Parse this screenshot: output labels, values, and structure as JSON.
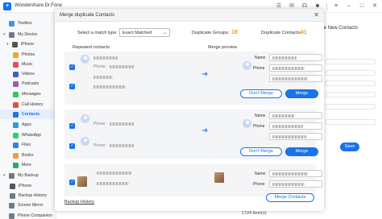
{
  "app": {
    "title": "Wondershare Dr.Fone",
    "logo": "+"
  },
  "titlebar_icons": [
    "hamburger-icon",
    "mail-icon",
    "headset-icon",
    "user-icon",
    "list-icon",
    "minimize-icon",
    "maximize-icon",
    "close-icon"
  ],
  "sidebar": {
    "items": [
      {
        "label": "Toolbox",
        "icon_color": "#4a90e2",
        "level": 0
      },
      {
        "label": "My Device",
        "icon_color": "#6f7b8a",
        "level": 0,
        "expanded": true
      },
      {
        "label": "iPhone",
        "icon_color": "#555555",
        "level": 1,
        "expanded": true
      },
      {
        "label": "Photos",
        "icon_color": "#f5a623",
        "level": 2
      },
      {
        "label": "Music",
        "icon_color": "#e94b5b",
        "level": 2
      },
      {
        "label": "Videos",
        "icon_color": "#3b5bdb",
        "level": 2
      },
      {
        "label": "Podcasts",
        "icon_color": "#9b59b6",
        "level": 2
      },
      {
        "label": "Messages",
        "icon_color": "#34c759",
        "level": 2
      },
      {
        "label": "Call History",
        "icon_color": "#e74c3c",
        "level": 2
      },
      {
        "label": "Contacts",
        "icon_color": "#1a73e8",
        "level": 2,
        "active": true
      },
      {
        "label": "Apps",
        "icon_color": "#2d9cdb",
        "level": 2
      },
      {
        "label": "WhatsApp",
        "icon_color": "#25d366",
        "level": 2
      },
      {
        "label": "Files",
        "icon_color": "#2f80ed",
        "level": 2
      },
      {
        "label": "Books",
        "icon_color": "#f2994a",
        "level": 2
      },
      {
        "label": "More",
        "icon_color": "#27ae60",
        "level": 2
      },
      {
        "label": "My Backup",
        "icon_color": "#6f7b8a",
        "level": 0,
        "expanded": true
      },
      {
        "label": "iPhone",
        "icon_color": "#555555",
        "level": 1
      },
      {
        "label": "Backup History",
        "icon_color": "#6f7b8a",
        "level": 1
      },
      {
        "label": "Screen Mirror",
        "icon_color": "#6f7b8a",
        "level": 0
      },
      {
        "label": "Phone Companion",
        "icon_color": "#6f7b8a",
        "level": 0
      }
    ]
  },
  "background": {
    "heading": "te New Contacts",
    "save_label": "Save",
    "status": "1724  item(s)"
  },
  "dialog": {
    "title": "Merge duplicate Contacts",
    "match_label": "Select a match type:",
    "match_value": "Exact Matched",
    "groups_label": "Duplicate Groups:",
    "groups_value": "18",
    "dups_label": "Duplicate Contacts:",
    "dups_value": "41",
    "col_left": "Repeated contacts",
    "col_right": "Merge preview",
    "name_label": "Name",
    "phone_label": "Phone",
    "phone_prefix": "Phone:",
    "dont_merge": "Don't Merge",
    "merge": "Merge",
    "merge_contacts": "Merge Contacts",
    "backup_history": "Backup History"
  },
  "colors": {
    "accent": "#1a73e8",
    "counter": "#f29c11"
  }
}
